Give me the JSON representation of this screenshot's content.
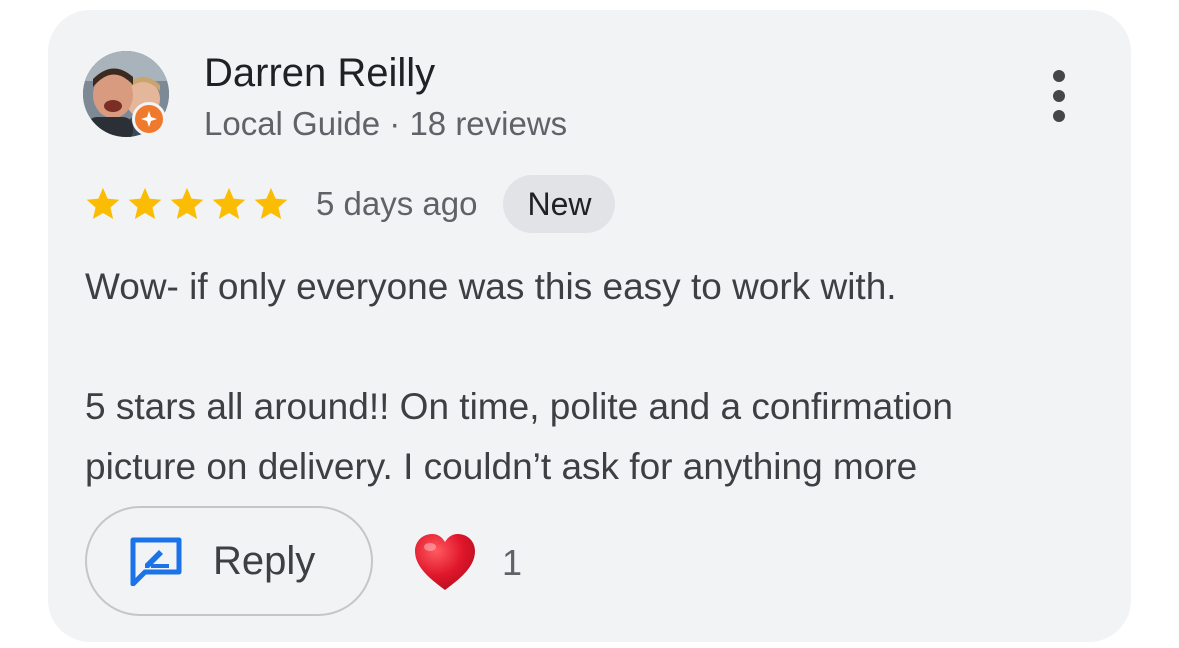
{
  "reviewer": {
    "name": "Darren Reilly",
    "meta": "Local Guide · 18 reviews",
    "avatar_icon": "profile-photo",
    "badge_icon": "local-guide-badge-icon"
  },
  "review": {
    "rating": 5,
    "rating_max": 5,
    "date": "5 days ago",
    "badge": "New",
    "paragraphs": {
      "p1": "Wow- if only everyone was this easy to work with.",
      "p2_line1": "5 stars all around!! On time, polite and a confirmation",
      "p2_line2": "picture on delivery. I couldn’t ask for anything more"
    }
  },
  "actions": {
    "reply_label": "Reply",
    "reaction_count": "1",
    "reaction_icon": "heart-icon",
    "more_icon": "more-vert-icon"
  },
  "colors": {
    "card_bg": "#f2f3f5",
    "star": "#fbbc04",
    "reply_icon": "#1a73e8",
    "heart": "#e0162b",
    "badge_bg": "#e1e3e6",
    "guide_badge": "#ef7a2e"
  }
}
